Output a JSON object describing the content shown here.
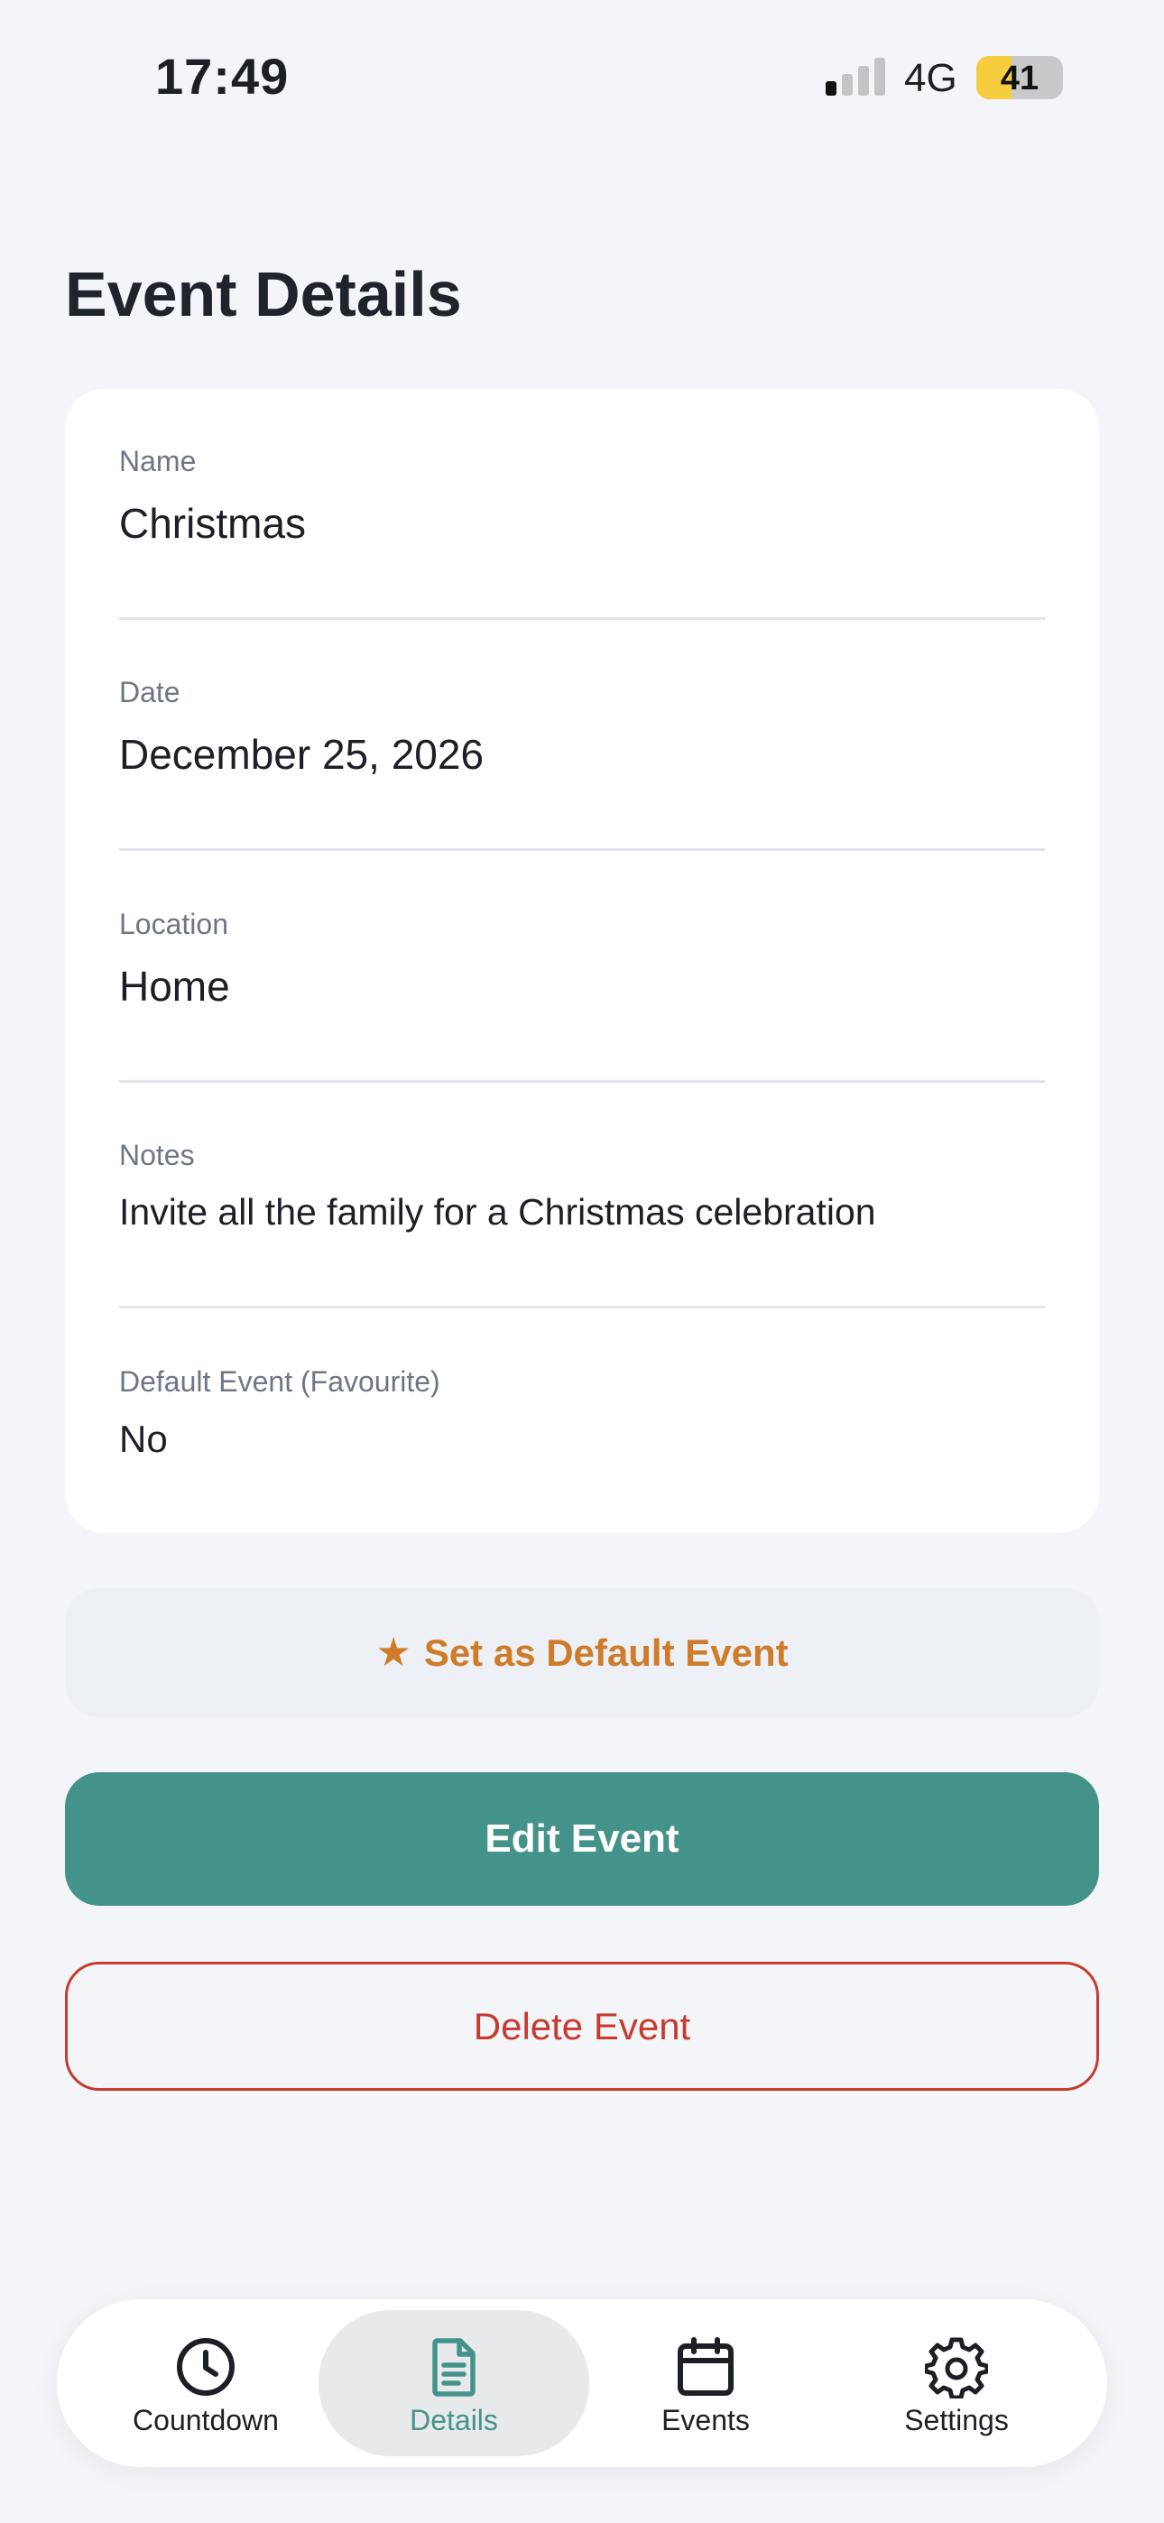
{
  "status_bar": {
    "time": "17:49",
    "network": "4G",
    "battery_level": "41",
    "battery_fraction": 0.41
  },
  "page": {
    "title": "Event Details"
  },
  "fields": [
    {
      "label": "Name",
      "value": "Christmas"
    },
    {
      "label": "Date",
      "value": "December 25, 2026"
    },
    {
      "label": "Location",
      "value": "Home"
    },
    {
      "label": "Notes",
      "value": "Invite all the family for a Christmas celebration"
    },
    {
      "label": "Default Event (Favourite)",
      "value": "No"
    }
  ],
  "actions": {
    "set_default_label": "Set as Default Event",
    "edit_label": "Edit Event",
    "delete_label": "Delete Event"
  },
  "tabs": [
    {
      "label": "Countdown",
      "icon": "clock-icon",
      "active": false
    },
    {
      "label": "Details",
      "icon": "document-icon",
      "active": true
    },
    {
      "label": "Events",
      "icon": "calendar-icon",
      "active": false
    },
    {
      "label": "Settings",
      "icon": "gear-icon",
      "active": false
    }
  ],
  "colors": {
    "accent": "#44938a",
    "favourite": "#cf7b2a",
    "danger": "#c73a2e",
    "background": "#f4f5f9"
  }
}
